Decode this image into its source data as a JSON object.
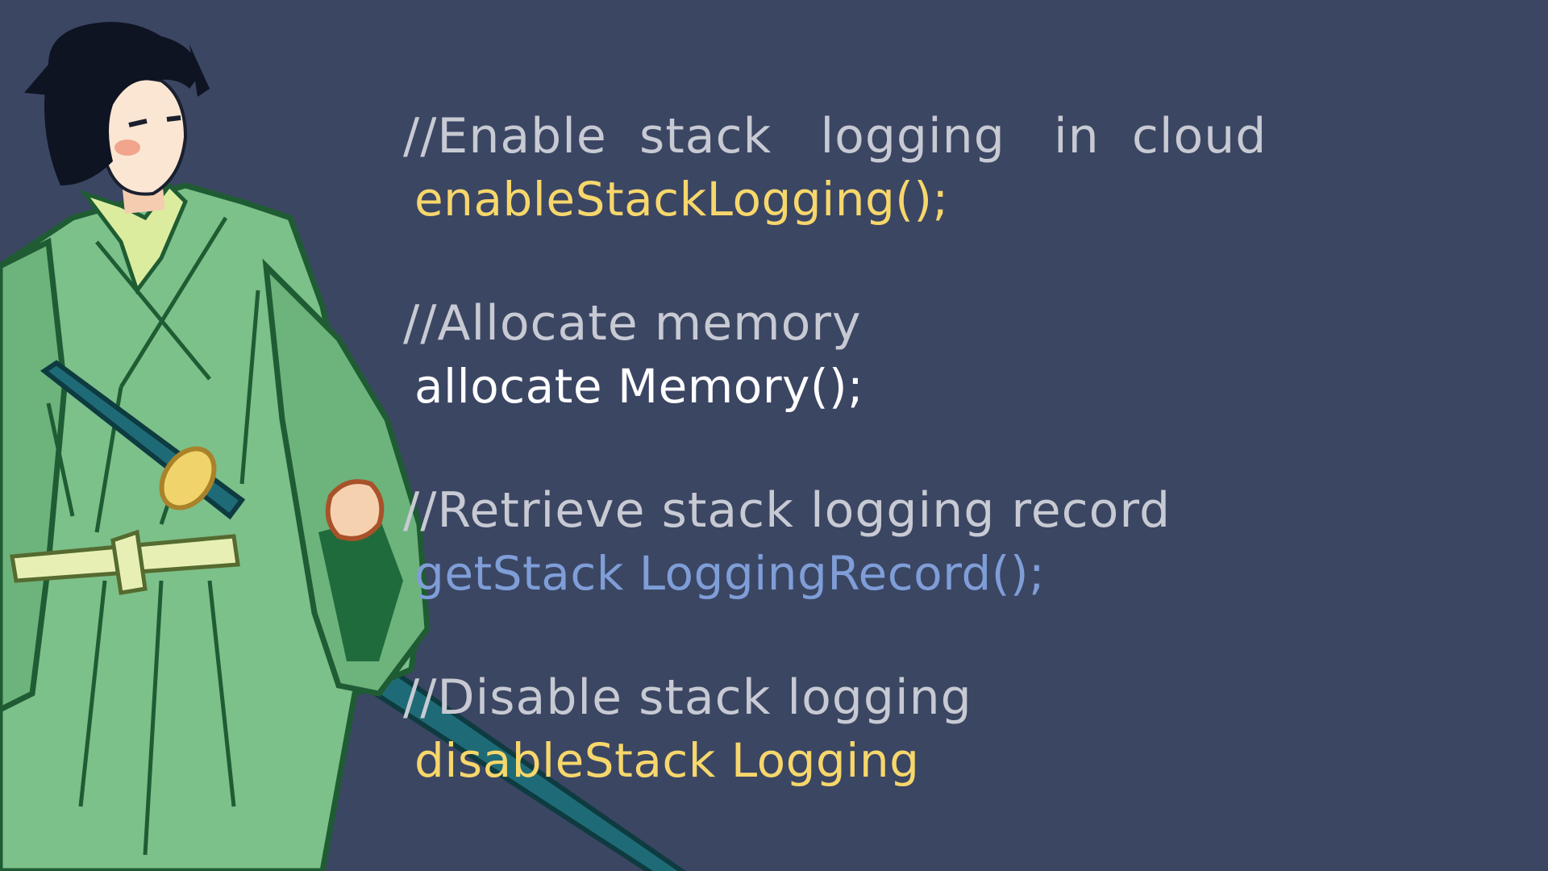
{
  "colors": {
    "background": "#3b4663",
    "comment": "#c8cad3",
    "call_yellow": "#f7d76b",
    "call_white": "#ffffff",
    "call_blue": "#7f9ed8",
    "robe_green": "#7cc08a",
    "robe_dark": "#1f6b3c",
    "sword_teal": "#1e6b77"
  },
  "illustration": {
    "icon": "samurai-figure-icon"
  },
  "code": [
    {
      "comment": "//Enable  stack   logging   in  cloud",
      "call": "enableStackLogging();",
      "color": "yellow"
    },
    {
      "comment": "//Allocate memory",
      "call": "allocate Memory();",
      "color": "white"
    },
    {
      "comment": "//Retrieve stack logging record",
      "call": "getStack LoggingRecord();",
      "color": "blue"
    },
    {
      "comment": "//Disable stack logging",
      "call": "disableStack Logging",
      "color": "yellow"
    }
  ]
}
